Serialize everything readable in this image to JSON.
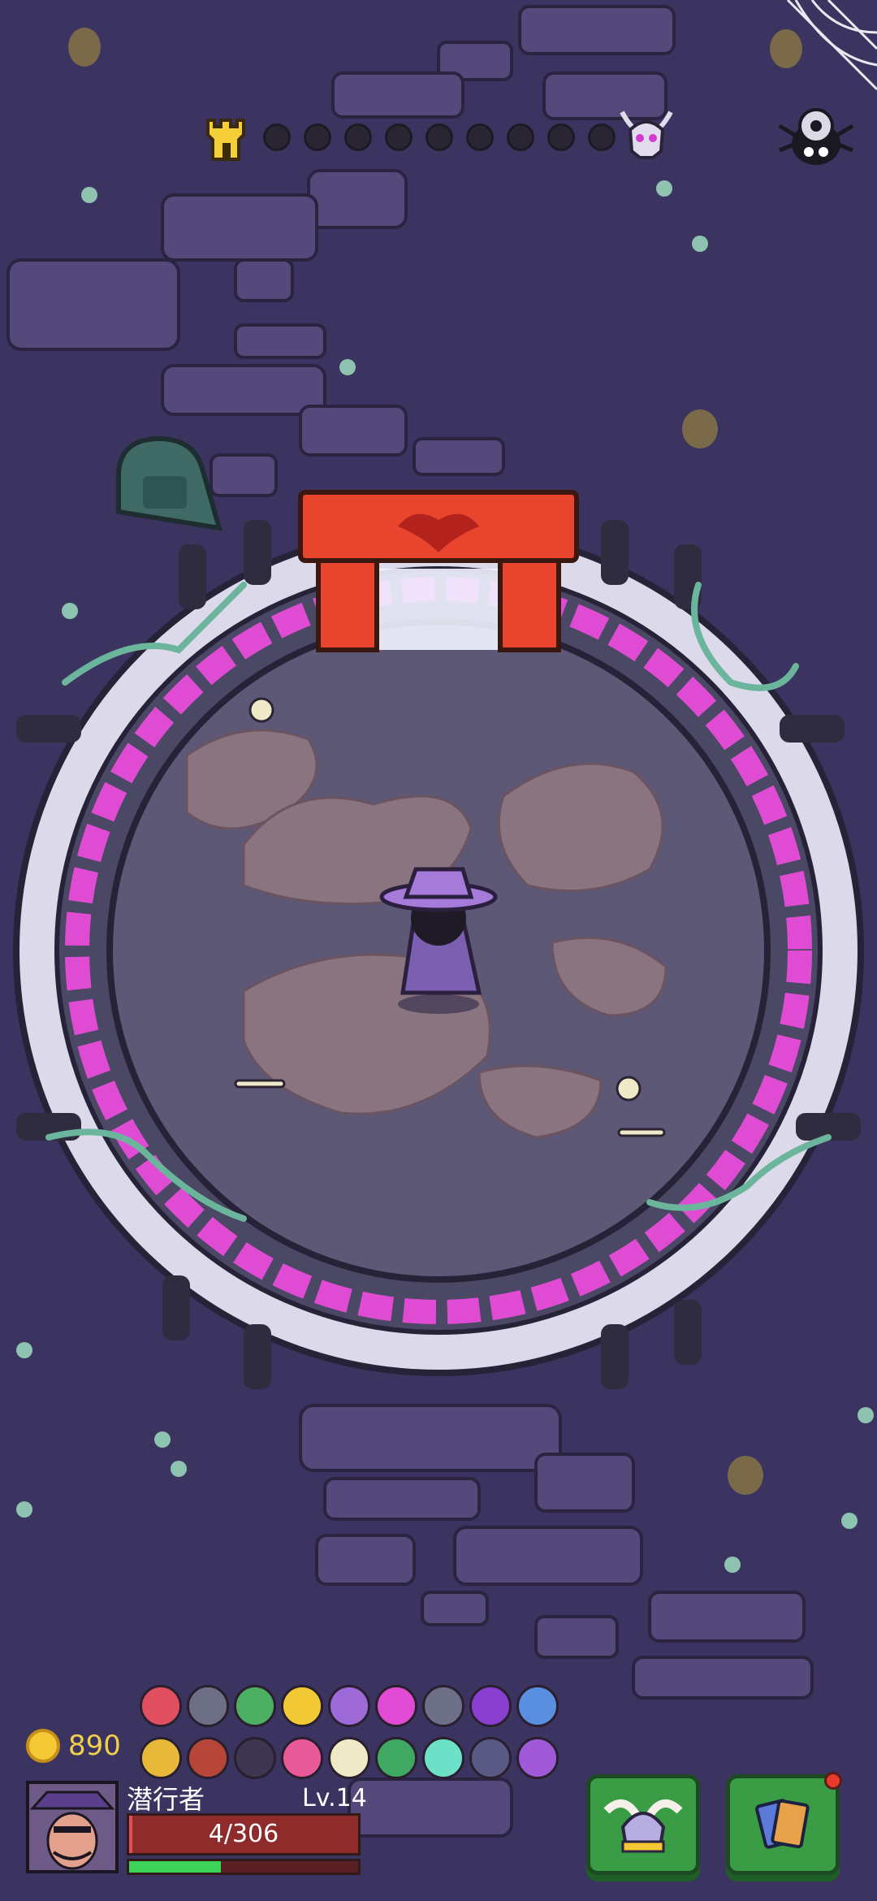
{
  "progress": {
    "start_icon": "tower-icon",
    "boss_icon": "demon-skull-icon",
    "stage_dots": 9
  },
  "settings": {
    "icon": "gear-spider-icon"
  },
  "player": {
    "coins": "890",
    "name": "潜行者",
    "level": "Lv.14",
    "hp": "4/306",
    "hp_fraction": 0.013,
    "xp_fraction": 0.4
  },
  "relics": [
    [
      "heart-lock-icon",
      "stone-face-icon",
      "green-slime-icon",
      "gold-coin-icon",
      "purple-web-icon",
      "pink-flower-icon",
      "stone-face-icon",
      "purple-demon-icon",
      "blue-flame-icon"
    ],
    [
      "yellow-key-icon",
      "red-shield-icon",
      "dark-claw-icon",
      "pink-virus-icon",
      "bone-icon",
      "green-tentacle-icon",
      "potion-icon",
      "paw-badge-icon",
      "shield-badge-icon"
    ]
  ],
  "buttons": {
    "left_icon": "winged-helmet-icon",
    "right_icon": "cards-icon"
  },
  "colors": {
    "floor": "#3b3460",
    "arena_floor": "#5d5876",
    "arena_glow": "#e04bd4",
    "gate": "#e9452e",
    "button": "#3a9c45"
  }
}
